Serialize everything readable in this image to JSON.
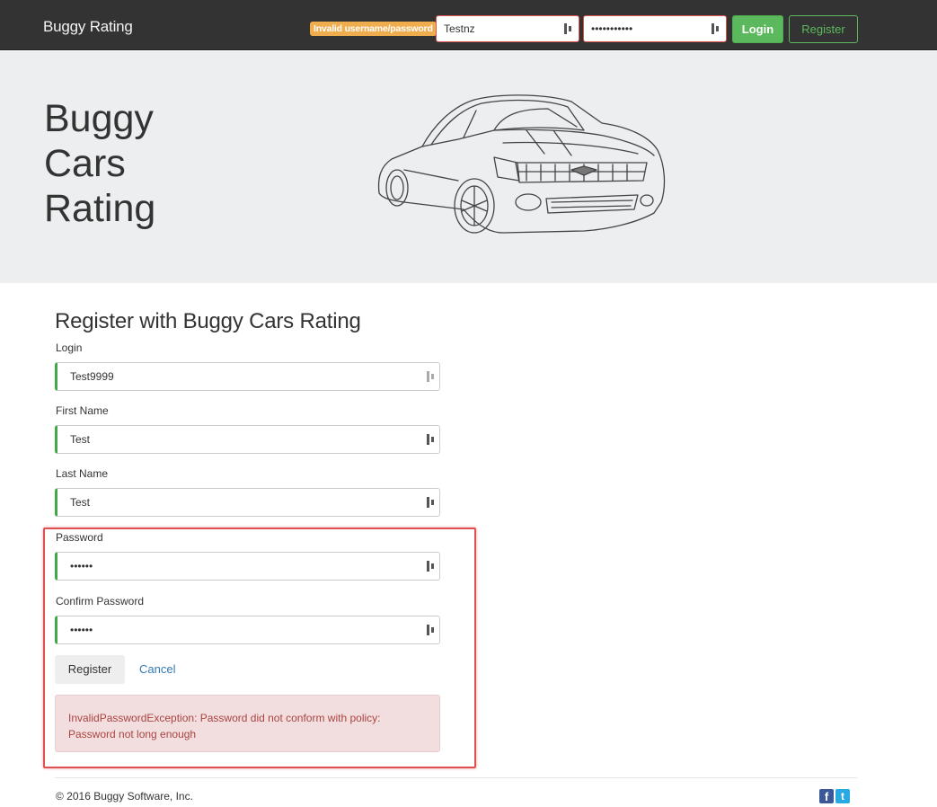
{
  "navbar": {
    "brand": "Buggy Rating",
    "alert": "Invalid username/password",
    "username_value": "Testnz",
    "password_value": "•••••••••••",
    "login_label": "Login",
    "register_label": "Register"
  },
  "jumbotron": {
    "title_lines": [
      "Buggy",
      "Cars",
      "Rating"
    ]
  },
  "form": {
    "heading": "Register with Buggy Cars Rating",
    "fields": [
      {
        "label": "Login",
        "value": "Test9999"
      },
      {
        "label": "First Name",
        "value": "Test"
      },
      {
        "label": "Last Name",
        "value": "Test"
      },
      {
        "label": "Password",
        "value": "••••••"
      },
      {
        "label": "Confirm Password",
        "value": "••••••"
      }
    ],
    "register_label": "Register",
    "cancel_label": "Cancel",
    "error_message": "InvalidPasswordException: Password did not conform with policy: Password not long enough"
  },
  "footer": {
    "copyright": "© 2016 Buggy Software, Inc.",
    "social": [
      {
        "name": "facebook-icon",
        "glyph": "f",
        "color": "#3b5998"
      },
      {
        "name": "twitter-icon",
        "glyph": "t",
        "color": "#29a9e1"
      }
    ]
  },
  "colors": {
    "navbar_bg": "#333333",
    "accent_green": "#5cb85c",
    "alert_orange": "#f0ad4e",
    "error_text": "#a94442",
    "highlight_red": "#e05050"
  }
}
